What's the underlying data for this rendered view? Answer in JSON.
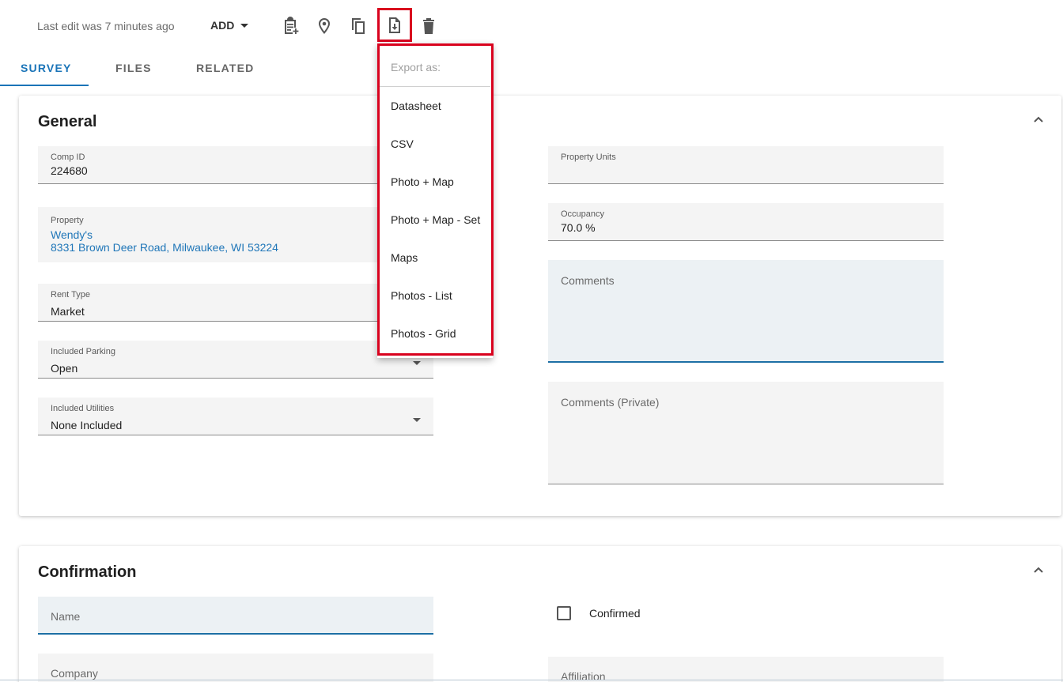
{
  "toolbar": {
    "last_edit": "Last edit was 7 minutes ago",
    "add_label": "ADD"
  },
  "tabs": [
    {
      "label": "SURVEY"
    },
    {
      "label": "FILES"
    },
    {
      "label": "RELATED"
    }
  ],
  "general": {
    "title": "General",
    "comp_id": {
      "label": "Comp ID",
      "value": "224680"
    },
    "property": {
      "label": "Property",
      "name": "Wendy's",
      "address": "8331 Brown Deer Road, Milwaukee, WI 53224"
    },
    "rent_type": {
      "label": "Rent Type",
      "value": "Market"
    },
    "included_parking": {
      "label": "Included Parking",
      "value": "Open"
    },
    "included_utilities": {
      "label": "Included Utilities",
      "value": "None Included"
    },
    "property_units": {
      "label": "Property Units",
      "value": ""
    },
    "occupancy": {
      "label": "Occupancy",
      "value": "70.0 %"
    },
    "comments": {
      "placeholder": "Comments"
    },
    "comments_private": {
      "placeholder": "Comments (Private)"
    }
  },
  "confirmation": {
    "title": "Confirmation",
    "name": {
      "placeholder": "Name"
    },
    "company": {
      "placeholder": "Company"
    },
    "confirmed": {
      "label": "Confirmed"
    },
    "affiliation": {
      "placeholder": "Affiliation"
    }
  },
  "export_menu": {
    "header": "Export as:",
    "items": [
      {
        "label": "Datasheet"
      },
      {
        "label": "CSV"
      },
      {
        "label": "Photo + Map"
      },
      {
        "label": "Photo + Map - Set"
      },
      {
        "label": "Maps"
      },
      {
        "label": "Photos - List"
      },
      {
        "label": "Photos - Grid"
      }
    ]
  },
  "colors": {
    "accent": "#1a74b8",
    "highlight_outline": "#d9021e",
    "field_bg": "#f4f4f4",
    "field_bg_blue": "#ecf1f4"
  },
  "icons": [
    "clipboard-add-icon",
    "map-pin-icon",
    "copy-icon",
    "file-download-icon",
    "trash-icon",
    "chevron-up-icon",
    "dropdown-arrow-icon"
  ]
}
